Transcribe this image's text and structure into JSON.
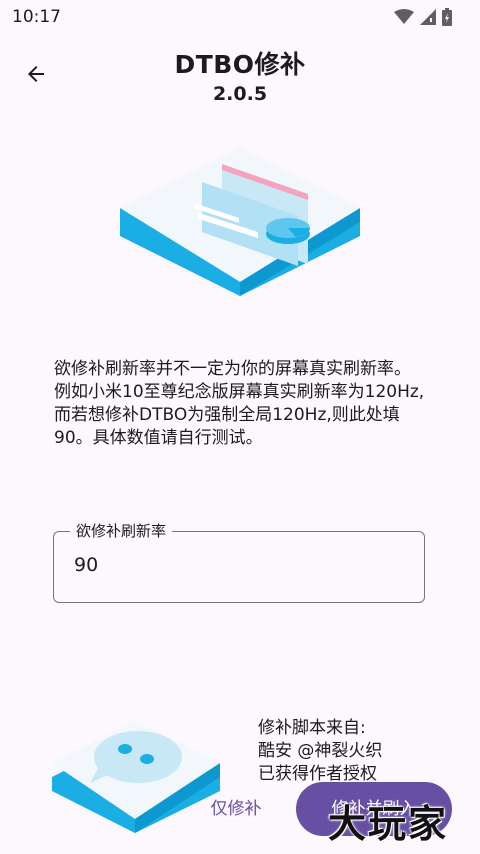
{
  "status_bar": {
    "time": "10:17"
  },
  "header": {
    "title": "DTBO修补",
    "version": "2.0.5"
  },
  "description": "欲修补刷新率并不一定为你的屏幕真实刷新率。\n例如小米10至尊纪念版屏幕真实刷新率为120Hz,而若想修补DTBO为强制全局120Hz,则此处填90。具体数值请自行测试。",
  "refresh_field": {
    "label": "欲修补刷新率",
    "value": "90"
  },
  "credits": {
    "text": "修补脚本来自:\n酷安 @神裂火织\n已获得作者授权"
  },
  "actions": {
    "patch_only": "仅修补",
    "patch_and_flash": "修补并刷入"
  },
  "watermark": "大玩家",
  "colors": {
    "accent": "#6750a4",
    "illustration_cyan": "#1aaee5",
    "illustration_pink": "#f6a3c0"
  }
}
